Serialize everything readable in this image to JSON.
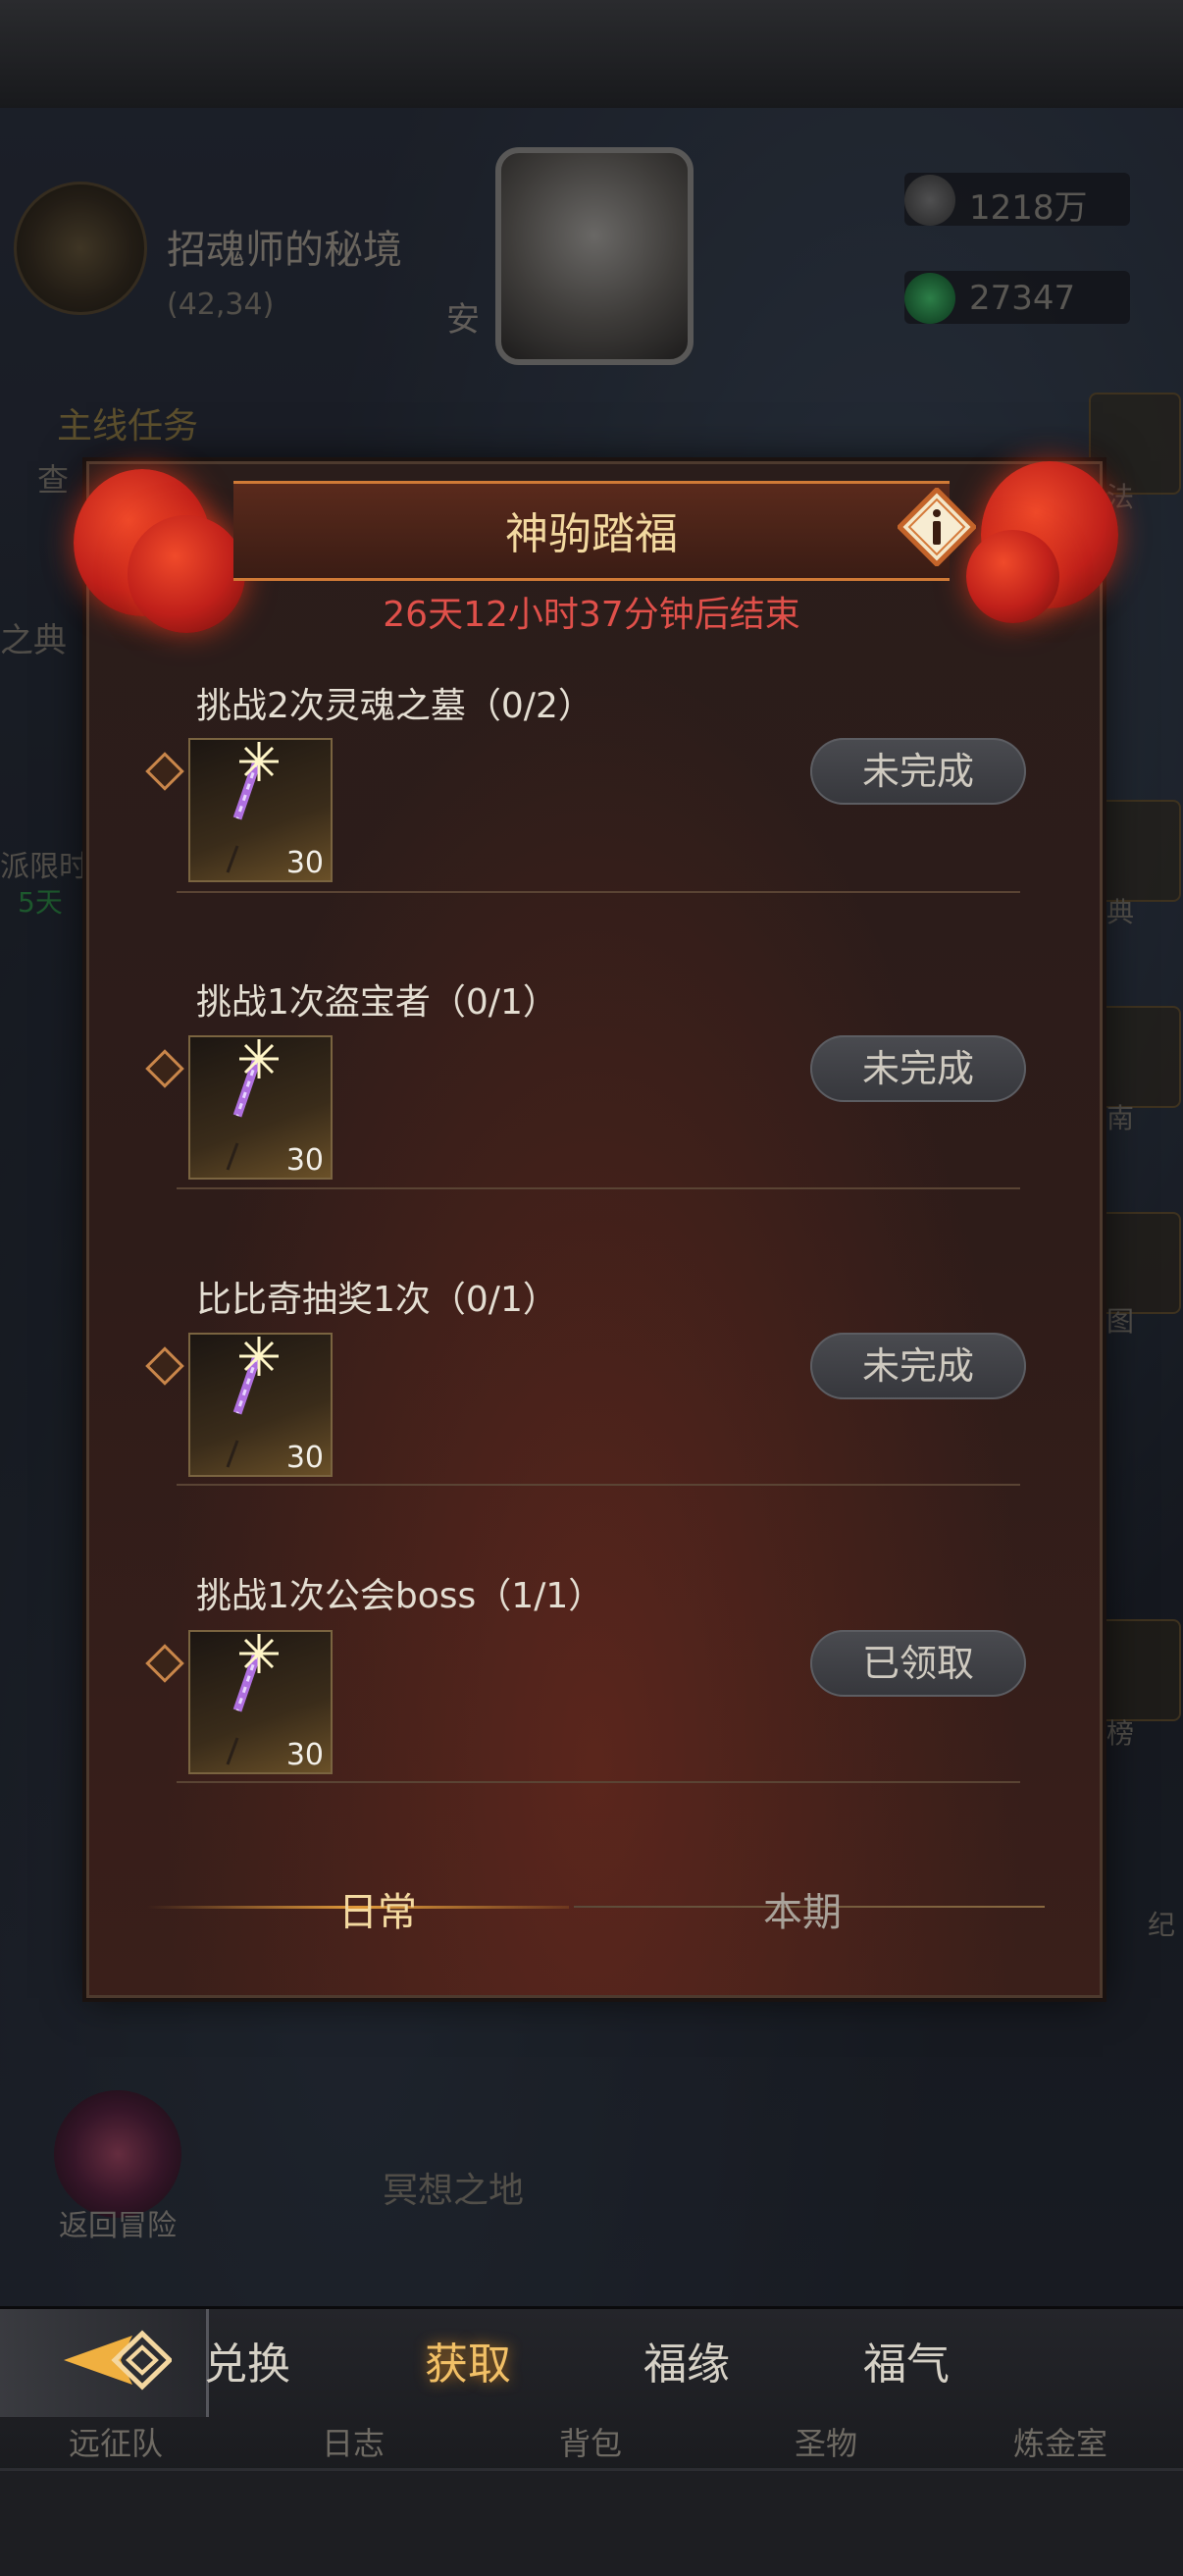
{
  "hud": {
    "location_name": "招魂师的秘境",
    "coords": "(42,34)",
    "portrait_label": "安",
    "silver": "1218万",
    "gems": "27347"
  },
  "left_panel": {
    "quest_header": "主线任务",
    "quest_sub": "查",
    "side_text_1": "之典",
    "side_text_2": "派限时",
    "side_text_3": "5天"
  },
  "right_panel": {
    "labels": [
      "法",
      "典",
      "南",
      "图",
      "榜",
      "纪"
    ]
  },
  "map": {
    "return_label": "返回冒险",
    "area_label": "冥想之地"
  },
  "modal": {
    "title": "神驹踏福",
    "timer": "26天12小时37分钟后结束",
    "tasks": [
      {
        "title": "挑战2次灵魂之墓（0/2）",
        "reward_count": "30",
        "status": "未完成"
      },
      {
        "title": "挑战1次盗宝者（0/1）",
        "reward_count": "30",
        "status": "未完成"
      },
      {
        "title": "比比奇抽奖1次（0/1）",
        "reward_count": "30",
        "status": "未完成"
      },
      {
        "title": "挑战1次公会boss（1/1）",
        "reward_count": "30",
        "status": "已领取"
      }
    ],
    "tabs": {
      "daily": "日常",
      "period": "本期"
    }
  },
  "bottom_nav": {
    "tabs": [
      "兑换",
      "获取",
      "福缘",
      "福气"
    ],
    "active_tab": "获取",
    "under_labels": [
      "远征队",
      "日志",
      "背包",
      "圣物",
      "炼金室"
    ]
  },
  "colors": {
    "timer": "#e0504a",
    "accent_gold": "#f2c066",
    "title_text": "#f3d9a0"
  }
}
